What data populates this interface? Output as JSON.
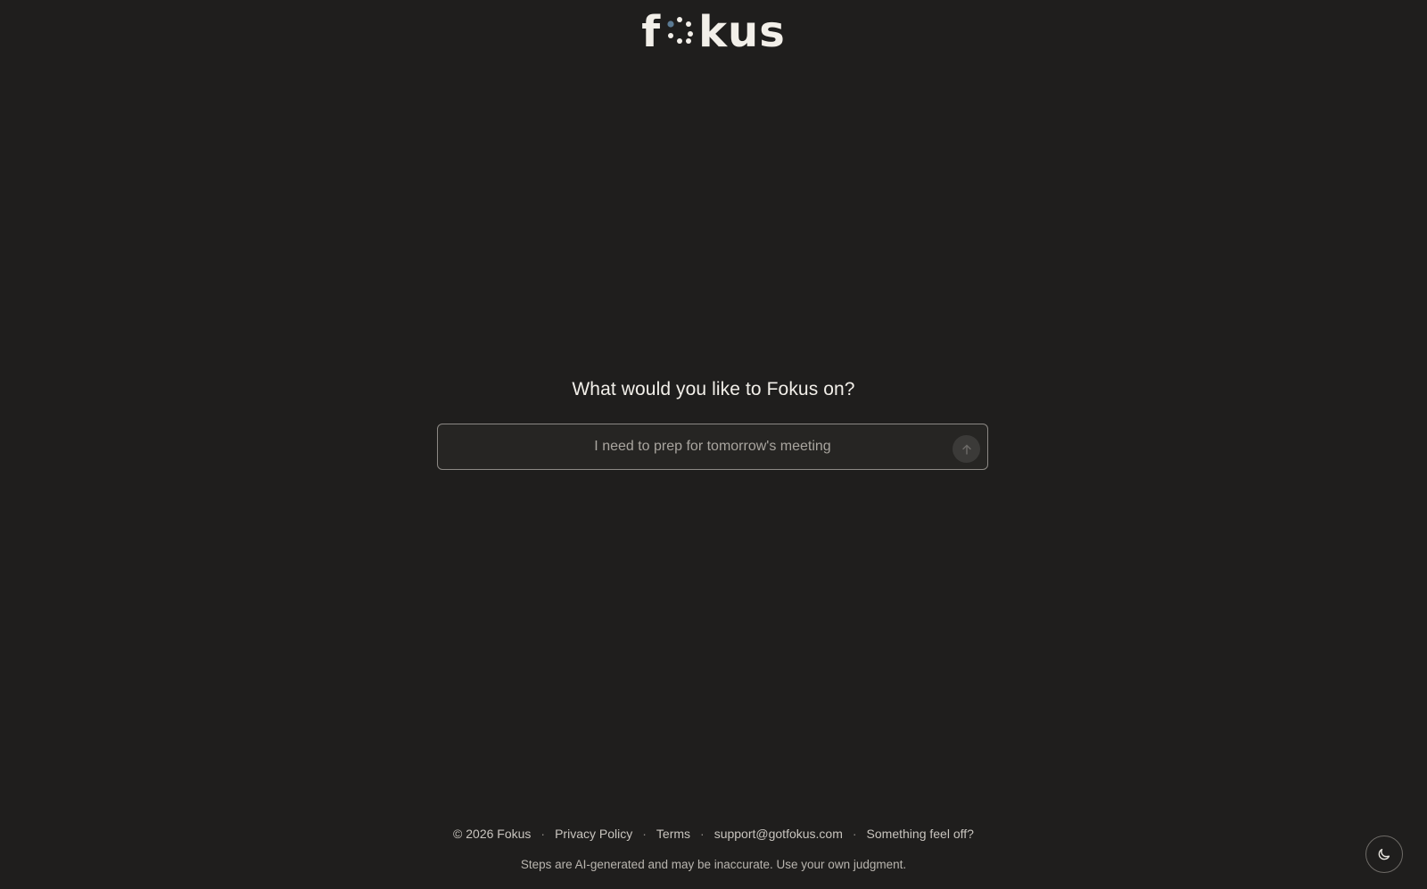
{
  "logo": {
    "text_left": "f",
    "text_right": "kus",
    "dots_accent_color": "#5b7a93"
  },
  "prompt": {
    "title": "What would you like to Fokus on?",
    "input_placeholder": "I need to prep for tomorrow's meeting",
    "input_value": "",
    "submit_icon": "arrow-up-icon"
  },
  "footer": {
    "copyright": "© 2026 Fokus",
    "links": {
      "privacy": "Privacy Policy",
      "terms": "Terms",
      "support": "support@gotfokus.com",
      "feedback": "Something feel off?"
    },
    "separator": "·",
    "disclaimer": "Steps are AI-generated and may be inaccurate. Use your own judgment."
  },
  "theme_toggle": {
    "icon": "moon-icon"
  }
}
